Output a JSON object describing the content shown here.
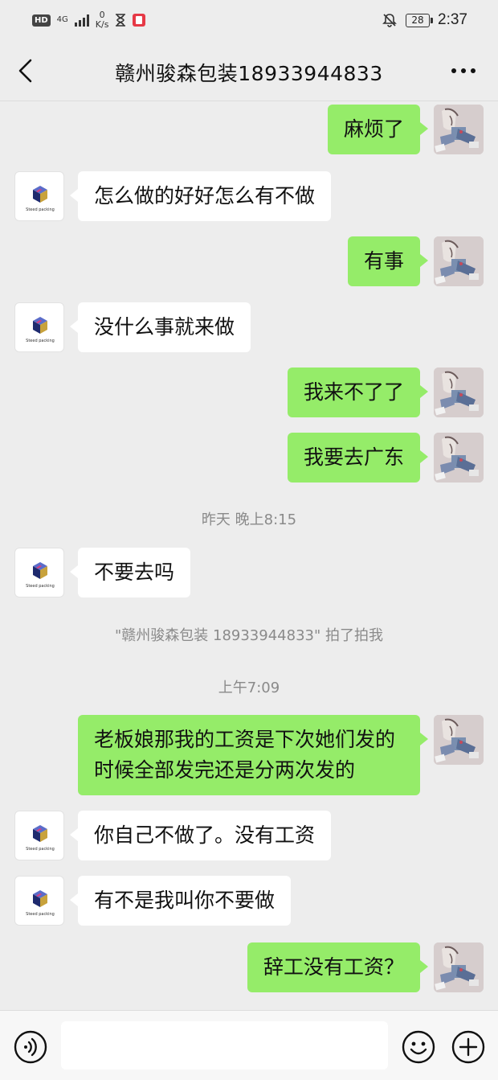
{
  "status_bar": {
    "hd": "HD",
    "network": "4G",
    "speed_value": "0",
    "speed_unit": "K/s",
    "battery": "28",
    "time": "2:37"
  },
  "header": {
    "title": "赣州骏森包装18933944833"
  },
  "messages": [
    {
      "side": "out",
      "text": "麻烦了"
    },
    {
      "side": "in",
      "text": "怎么做的好好怎么有不做"
    },
    {
      "side": "out",
      "text": "有事"
    },
    {
      "side": "in",
      "text": "没什么事就来做"
    },
    {
      "side": "out",
      "text": "我来不了了"
    },
    {
      "side": "out",
      "text": "我要去广东"
    },
    {
      "side": "sys",
      "text": "昨天 晚上8:15"
    },
    {
      "side": "in",
      "text": "不要去吗"
    },
    {
      "side": "sys",
      "text": "\"赣州骏森包装 18933944833\" 拍了拍我"
    },
    {
      "side": "sys",
      "text": "上午7:09"
    },
    {
      "side": "out",
      "text": "老板娘那我的工资是下次她们发的时候全部发完还是分两次发的"
    },
    {
      "side": "in",
      "text": "你自己不做了。没有工资"
    },
    {
      "side": "in",
      "text": "有不是我叫你不要做"
    },
    {
      "side": "out",
      "text": "辞工没有工资？"
    }
  ],
  "contact_avatar": {
    "logo_text": "Steed packing"
  },
  "colors": {
    "background": "#ededed",
    "bubble_out": "#95ec69",
    "bubble_in": "#ffffff",
    "system_text": "#8a8a8a"
  },
  "icons": {
    "back": "chevron-left-icon",
    "more": "more-dots-icon",
    "voice": "voice-icon",
    "emoji": "emoji-icon",
    "plus": "plus-icon"
  }
}
